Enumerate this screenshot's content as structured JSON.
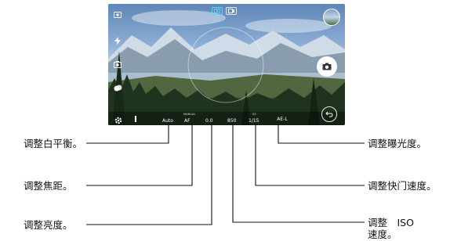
{
  "camera": {
    "params": {
      "white_balance": "Auto",
      "focus": "AF",
      "brightness": "0.0",
      "iso": "850",
      "shutter": "1/15",
      "ae_lock": "AE-L"
    },
    "param_headers": {
      "focus": "MANUAL",
      "shutter": "SS"
    }
  },
  "callouts": {
    "white_balance": "调整白平衡。",
    "focus": "调整焦距。",
    "brightness": "调整亮度。",
    "exposure": "调整曝光度。",
    "shutter_speed": "调整快门速度。",
    "iso_line1": "调整　ISO",
    "iso_line2": "速度。"
  },
  "icons": {
    "top_left": "camera-switch-icon",
    "flash": "flash-icon",
    "mode": "camera-mode-icon",
    "filter": "filter-icon",
    "settings": "gear-icon",
    "shutter": "camera-shutter-icon",
    "back": "back-arrow-icon"
  },
  "colors": {
    "line": "#111111",
    "active_tab": "#5cd6ff"
  }
}
